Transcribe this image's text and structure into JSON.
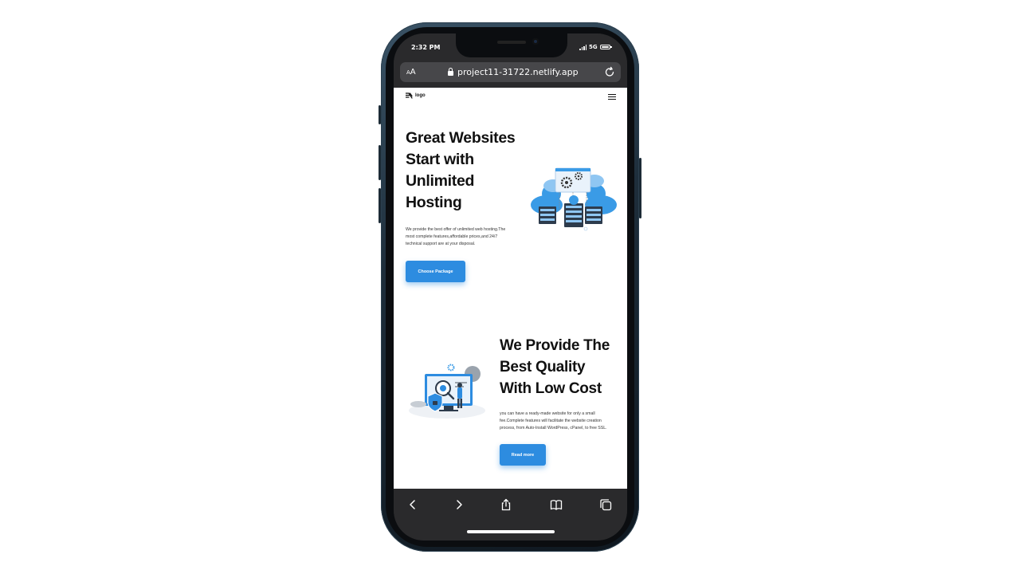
{
  "status": {
    "time": "2:32 PM",
    "network": "5G"
  },
  "browser": {
    "text_size": "AA",
    "url": "project11-31722.netlify.app",
    "icons": [
      "reload-icon",
      "back-icon",
      "forward-icon",
      "share-icon",
      "bookmarks-icon",
      "tabs-icon"
    ]
  },
  "site": {
    "logo": "logo",
    "hero": {
      "title": "Great Websites Start with Unlimited Hosting",
      "description": "We provide the best offer of unlimited web hosting.The most complete features,affordable prices,and 24/7 technical support are at your disposal.",
      "button": "Choose Package"
    },
    "feature": {
      "title": "We Provide The Best Quality With Low Cost",
      "description": "you can have a ready-made website for only a small fee.Complete features will facilitate the website creation process, from Auto-Install WordPress, cPanel, to free SSL.",
      "button": "Read more"
    }
  },
  "colors": {
    "accent": "#2d8ce0",
    "browser_chrome": "#2a2a2c",
    "frame": "#1e2e3b"
  }
}
